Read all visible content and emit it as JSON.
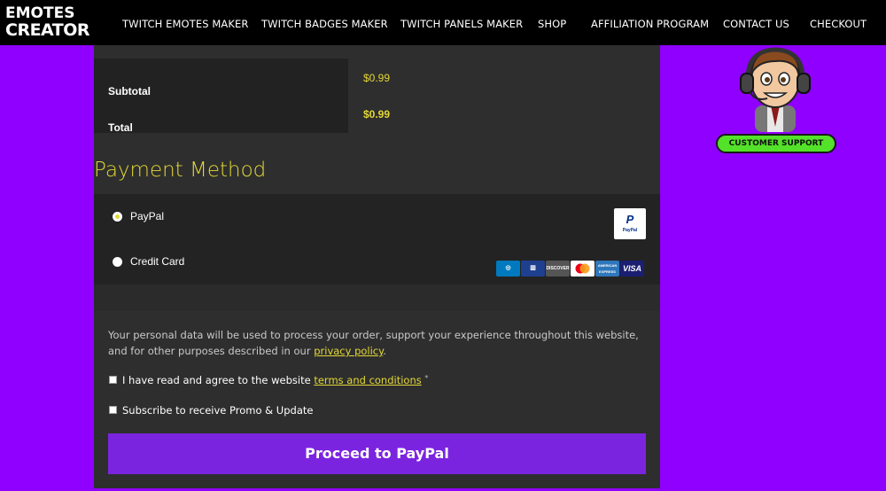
{
  "header": {
    "logo_line1": "EMOTES",
    "logo_line2": "CREATOR",
    "nav": [
      {
        "label": "TWITCH EMOTES MAKER"
      },
      {
        "label": "TWITCH BADGES MAKER"
      },
      {
        "label": "TWITCH PANELS MAKER"
      },
      {
        "label": "SHOP"
      },
      {
        "label": "AFFILIATION PROGRAM"
      },
      {
        "label": "CONTACT US"
      },
      {
        "label": "CHECKOUT"
      }
    ]
  },
  "totals": {
    "subtotal_label": "Subtotal",
    "subtotal_value": "$0.99",
    "total_label": "Total",
    "total_value": "$0.99"
  },
  "payment": {
    "title": "Payment Method",
    "options": [
      {
        "label": "PayPal",
        "selected": true
      },
      {
        "label": "Credit Card",
        "selected": false
      }
    ],
    "paypal_logo_text": "PayPal",
    "cards": [
      "Diners",
      "JCB",
      "DISCOVER",
      "MasterCard",
      "AMERICAN EXPRESS",
      "VISA"
    ]
  },
  "privacy": {
    "text": "Your personal data will be used to process your order, support your experience throughout this website, and for other purposes described in our ",
    "link": "privacy policy",
    "end": "."
  },
  "terms": {
    "text": "I have read and agree to the website ",
    "link": "terms and conditions",
    "required": "*"
  },
  "subscribe": {
    "label": "Subscribe to receive Promo & Update"
  },
  "proceed_label": "Proceed to PayPal",
  "support": {
    "label": "CUSTOMER SUPPORT"
  },
  "colors": {
    "accent": "#e3d836",
    "background": "#8f00ff",
    "button": "#7b24e0",
    "support": "#53e12a"
  }
}
